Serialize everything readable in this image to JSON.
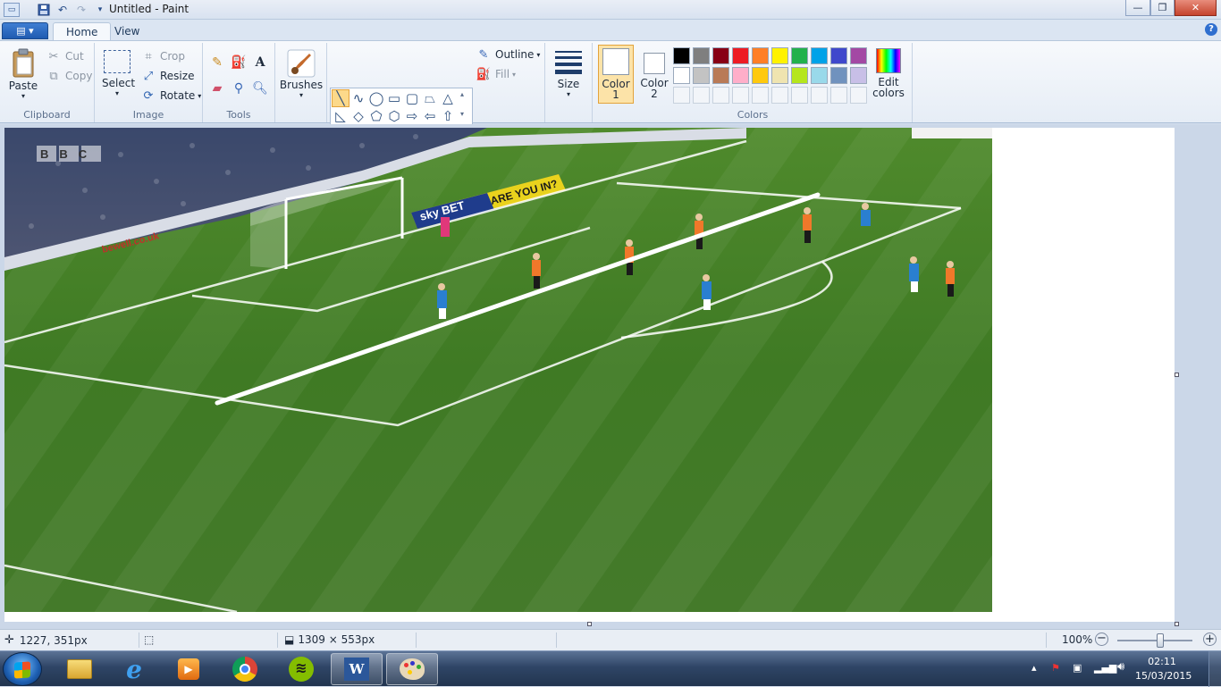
{
  "window": {
    "title": "Untitled - Paint",
    "minimize_label": "—",
    "maximize_label": "❐",
    "close_label": "✕"
  },
  "tabs": {
    "home": "Home",
    "view": "View",
    "help": "?"
  },
  "clipboard": {
    "paste": "Paste",
    "cut": "Cut",
    "copy": "Copy",
    "group": "Clipboard"
  },
  "image": {
    "select": "Select",
    "crop": "Crop",
    "resize": "Resize",
    "rotate": "Rotate",
    "group": "Image"
  },
  "tools": {
    "group": "Tools"
  },
  "brushes": {
    "label": "Brushes"
  },
  "shapes": {
    "outline": "Outline",
    "fill": "Fill",
    "group": "Shapes"
  },
  "size": {
    "label": "Size"
  },
  "colors": {
    "color1_label": "Color\n1",
    "color1_line1": "Color",
    "color1_line2": "1",
    "color2_line1": "Color",
    "color2_line2": "2",
    "edit_line1": "Edit",
    "edit_line2": "colors",
    "group": "Colors",
    "color1": "#ffffff",
    "color2": "#ffffff",
    "palette_row1": [
      "#000000",
      "#7f7f7f",
      "#880015",
      "#ed1c24",
      "#ff7f27",
      "#fff200",
      "#22b14c",
      "#00a2e8",
      "#3f48cc",
      "#a349a4"
    ],
    "palette_row2": [
      "#ffffff",
      "#c3c3c3",
      "#b97a57",
      "#ffaec9",
      "#ffc90e",
      "#efe4b0",
      "#b5e61d",
      "#99d9ea",
      "#7092be",
      "#c8bfe7"
    ]
  },
  "canvas_image": {
    "overlay_texts": [
      "BBC",
      "sky BET",
      "ARE YOU IN?",
      "bewell.co.uk"
    ],
    "line_color": "#ffffff"
  },
  "status": {
    "cursor_pos": "1227, 351px",
    "image_size": "1309 × 553px",
    "zoom": "100%",
    "zoom_level": 0.57
  },
  "taskbar": {
    "time": "02:11",
    "date": "15/03/2015",
    "apps": [
      "Windows Explorer",
      "Internet Explorer",
      "Media Player",
      "Google Chrome",
      "Spotify",
      "Microsoft Word",
      "Paint"
    ],
    "active_app": "Paint"
  }
}
